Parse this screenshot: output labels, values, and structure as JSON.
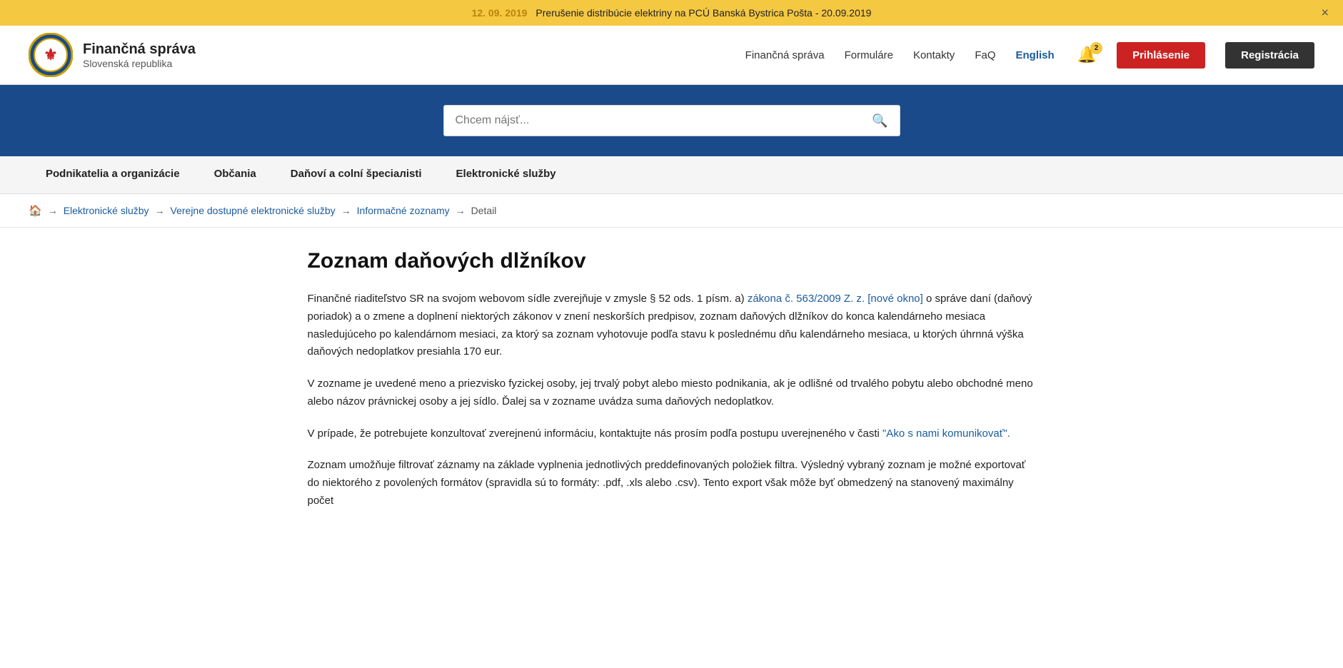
{
  "announcement": {
    "date": "12. 09. 2019",
    "text": "Prerušenie distribúcie elektriny na PCÚ Banská Bystrica Pošta - 20.09.2019",
    "close_label": "×"
  },
  "header": {
    "logo_title": "Finančná správa",
    "logo_subtitle": "Slovenská republika",
    "nav": {
      "items": [
        {
          "label": "Finančná správa"
        },
        {
          "label": "Formuláre"
        },
        {
          "label": "Kontakty"
        },
        {
          "label": "FaQ"
        },
        {
          "label": "English",
          "highlight": true
        }
      ]
    },
    "bell_count": "2",
    "btn_prihlasenie": "Prihlásenie",
    "btn_registracia": "Registrácia"
  },
  "search": {
    "placeholder": "Chcem nájsť..."
  },
  "main_nav": {
    "items": [
      {
        "label": "Podnikatelia a organizácie"
      },
      {
        "label": "Občania"
      },
      {
        "label": "Daňoví a colní špeciалisti"
      },
      {
        "label": "Elektronické služby"
      }
    ]
  },
  "breadcrumb": {
    "home_icon": "🏠",
    "items": [
      {
        "label": "Elektronické služby",
        "link": true
      },
      {
        "label": "Verejne dostupné elektronické služby",
        "link": true
      },
      {
        "label": "Informačné zoznamy",
        "link": true
      },
      {
        "label": "Detail",
        "link": false
      }
    ]
  },
  "page": {
    "title": "Zoznam daňových dlžníkov",
    "paragraphs": [
      {
        "id": "p1",
        "parts": [
          {
            "type": "text",
            "content": "Finančné riaditeľstvo SR na svojom webovom sídle zverejňuje v zmysle § 52 ods. 1 písm. a) "
          },
          {
            "type": "link",
            "content": "zákona č. 563/2009 Z. z. [nové okno]"
          },
          {
            "type": "text",
            "content": " o správe daní (daňový poriadok) a o zmene a doplnení niektorých zákonov v znení neskorších predpisov, zoznam daňových dlžníkov do konca kalendárneho mesiaca nasledujúceho po kalendárnom mesiaci, za ktorý sa zoznam vyhotovuje podľa stavu k poslednému dňu kalendárneho mesiaca, u ktorých úhrnná výška daňových nedoplatkov presiahla 170 eur."
          }
        ]
      },
      {
        "id": "p2",
        "parts": [
          {
            "type": "text",
            "content": "V zozname je uvedené meno a priezvisko fyzickej osoby, jej trvalý pobyt alebo miesto podnikania, ak je odlišné od trvalého pobytu alebo obchodné meno alebo názov právnickej osoby a jej sídlo. Ďalej sa v zozname uvádza suma daňových nedoplatkov."
          }
        ]
      },
      {
        "id": "p3",
        "parts": [
          {
            "type": "text",
            "content": "V prípade, že potrebujete konzultovať zverejnenú informáciu, kontaktujte nás prosím podľa postupu uverejneného v časti "
          },
          {
            "type": "link",
            "content": "\"Ako s nami komunikovať\"."
          }
        ]
      },
      {
        "id": "p4",
        "parts": [
          {
            "type": "text",
            "content": "Zoznam umožňuje filtrovať záznamy na základe vyplnenia jednotlivých preddefinovaných položiek filtra. Výsledný vybraný zoznam je možné exportovať do niektorého z povolených formátov (spravidla sú to formáty: .pdf, .xls alebo .csv). Tento export však môže byť obmedzený na stanovený maximálny počet"
          }
        ]
      }
    ]
  }
}
